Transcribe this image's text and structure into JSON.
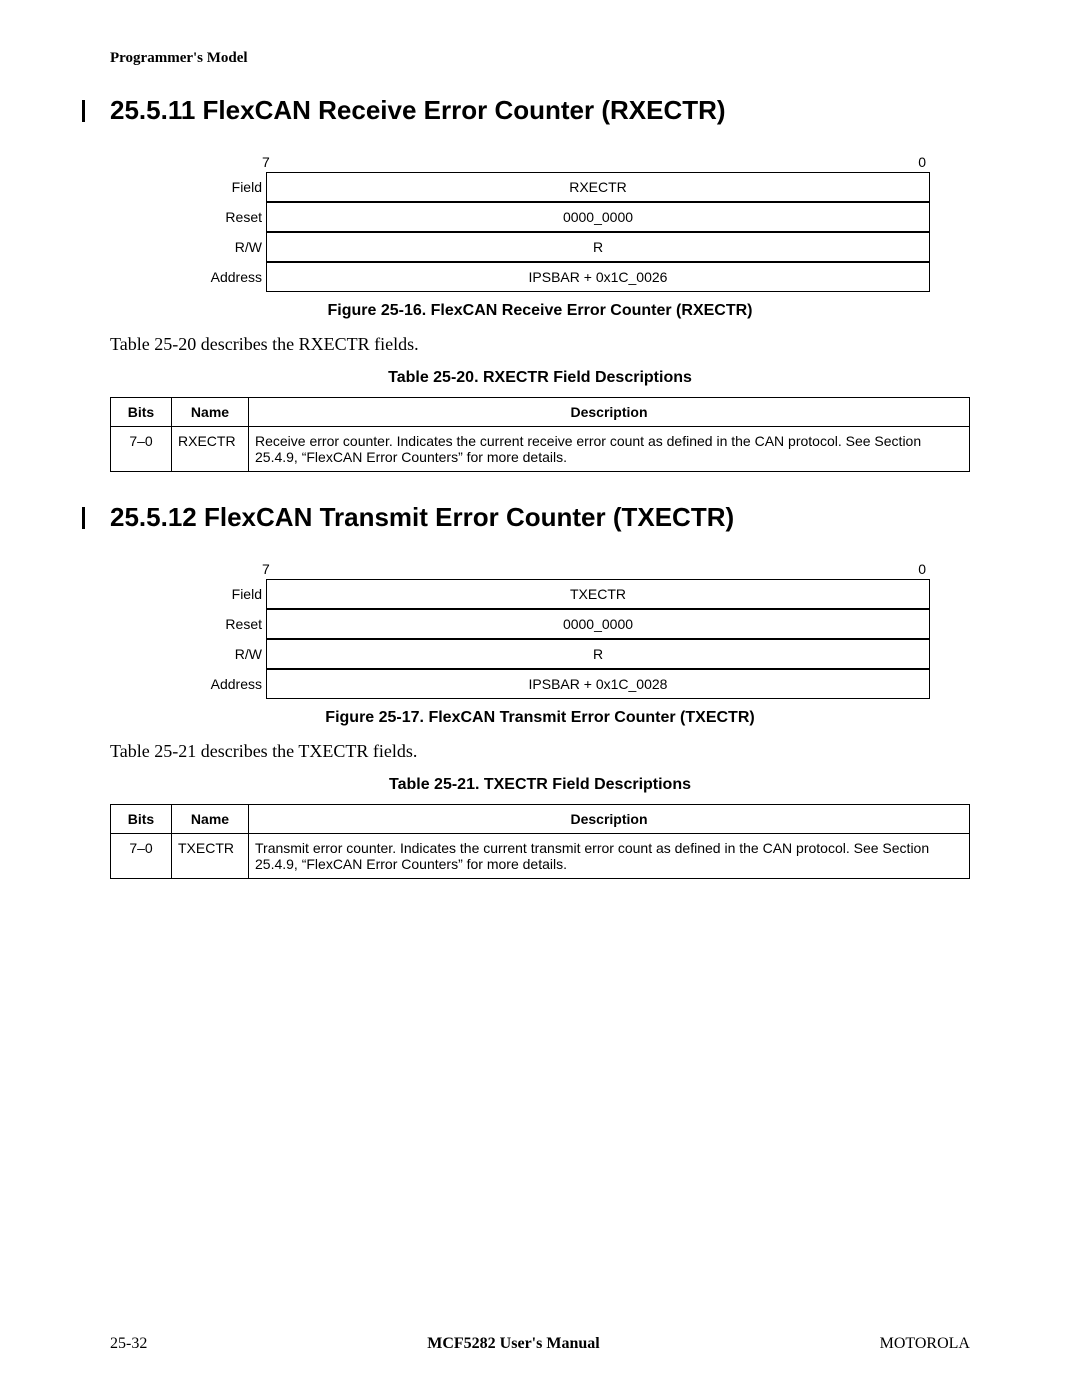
{
  "running_head": "Programmer's Model",
  "section1": {
    "number": "25.5.11",
    "title": "FlexCAN Receive Error Counter (RXECTR)",
    "bit_hi": "7",
    "bit_lo": "0",
    "rows": {
      "field_label": "Field",
      "field_value": "RXECTR",
      "reset_label": "Reset",
      "reset_value": "0000_0000",
      "rw_label": "R/W",
      "rw_value": "R",
      "addr_label": "Address",
      "addr_value": "IPSBAR + 0x1C_0026"
    },
    "figure_caption": "Figure 25-16. FlexCAN Receive Error Counter (RXECTR)",
    "body": "Table 25-20 describes the RXECTR fields.",
    "table_caption": "Table 25-20. RXECTR Field Descriptions",
    "headers": {
      "bits": "Bits",
      "name": "Name",
      "desc": "Description"
    },
    "row": {
      "bits": "7–0",
      "name": "RXECTR",
      "desc": "Receive error counter. Indicates the current receive error count as defined in the CAN protocol. See Section 25.4.9, “FlexCAN Error Counters” for more details."
    }
  },
  "section2": {
    "number": "25.5.12",
    "title": "FlexCAN Transmit Error Counter (TXECTR)",
    "bit_hi": "7",
    "bit_lo": "0",
    "rows": {
      "field_label": "Field",
      "field_value": "TXECTR",
      "reset_label": "Reset",
      "reset_value": "0000_0000",
      "rw_label": "R/W",
      "rw_value": "R",
      "addr_label": "Address",
      "addr_value": "IPSBAR + 0x1C_0028"
    },
    "figure_caption": "Figure 25-17. FlexCAN Transmit Error Counter (TXECTR)",
    "body": "Table 25-21 describes the TXECTR fields.",
    "table_caption": "Table 25-21. TXECTR Field Descriptions",
    "headers": {
      "bits": "Bits",
      "name": "Name",
      "desc": "Description"
    },
    "row": {
      "bits": "7–0",
      "name": "TXECTR",
      "desc": "Transmit error counter. Indicates the current transmit error count as defined in the CAN protocol. See Section 25.4.9, “FlexCAN Error Counters” for more details."
    }
  },
  "footer": {
    "left": "25-32",
    "center": "MCF5282 User's Manual",
    "right": "MOTOROLA"
  }
}
